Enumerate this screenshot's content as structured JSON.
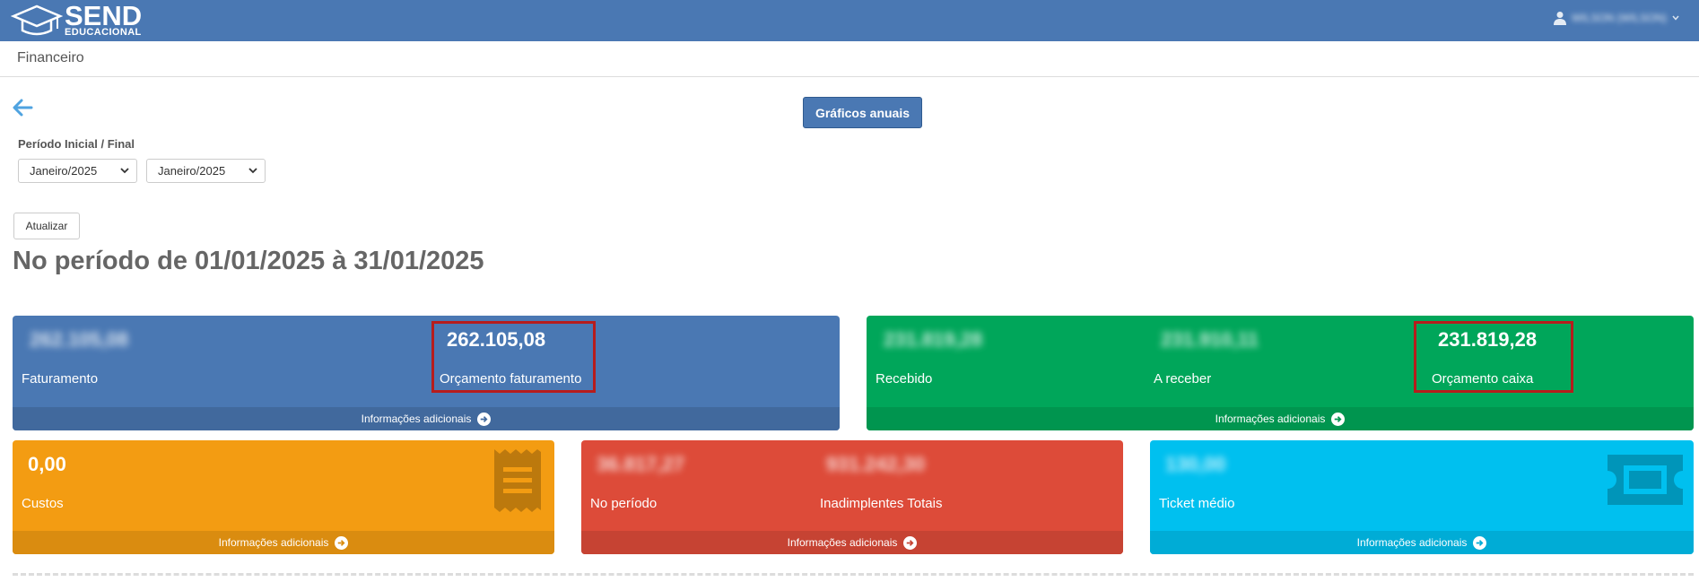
{
  "header": {
    "logo_main": "SEND",
    "logo_sub": "EDUCACIONAL",
    "user_name": "WILSON (WILSON)"
  },
  "breadcrumb": "Financeiro",
  "toolbar": {
    "annual_charts_label": "Gráficos anuais"
  },
  "filter": {
    "period_label": "Período Inicial / Final",
    "start_value": "Janeiro/2025",
    "end_value": "Janeiro/2025",
    "update_label": "Atualizar"
  },
  "period_title": "No período de 01/01/2025 à 31/01/2025",
  "boxes": {
    "faturamento": {
      "value1": "262.105,08",
      "label1": "Faturamento",
      "value2": "262.105,08",
      "label2": "Orçamento faturamento",
      "footer": "Informações adicionais"
    },
    "caixa": {
      "value1": "231.819,28",
      "label1": "Recebido",
      "value2": "231.910,11",
      "label2": "A receber",
      "value3": "231.819,28",
      "label3": "Orçamento caixa",
      "footer": "Informações adicionais"
    },
    "custos": {
      "value1": "0,00",
      "label1": "Custos",
      "footer": "Informações adicionais"
    },
    "inadimplentes": {
      "value1": "36.817,27",
      "label1": "No período",
      "value2": "931.242,30",
      "label2": "Inadimplentes Totais",
      "footer": "Informações adicionais"
    },
    "ticket": {
      "value1": "130,00",
      "label1": "Ticket médio",
      "footer": "Informações adicionais"
    }
  },
  "colors": {
    "primary": "#4a78b3",
    "green": "#00a65a",
    "orange": "#f39c12",
    "red": "#dd4b39",
    "cyan": "#00c0ef",
    "highlight": "#b71c1c"
  }
}
